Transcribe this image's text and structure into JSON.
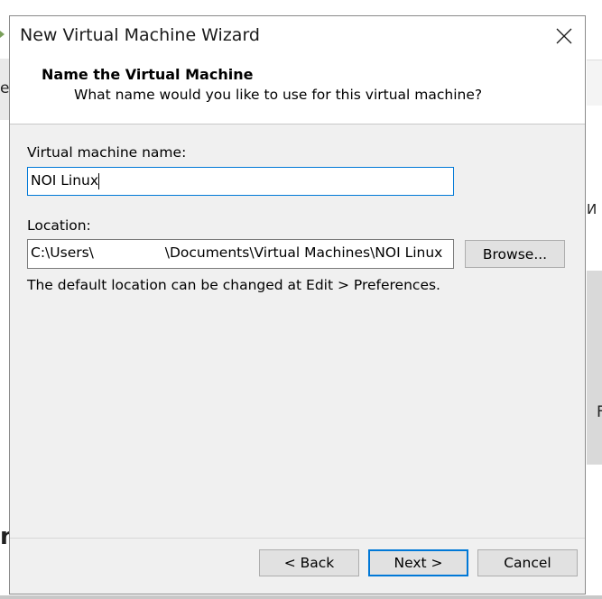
{
  "background": {
    "left_fragment": "e",
    "right_fragment_1": "И",
    "right_fragment_2": "F",
    "left_bottom_fragment": "n"
  },
  "dialog": {
    "title": "New Virtual Machine Wizard",
    "header_title": "Name the Virtual Machine",
    "header_subtitle": "What name would you like to use for this virtual machine?",
    "name_label": "Virtual machine name:",
    "name_value": "NOI Linux",
    "location_label": "Location:",
    "location_value": "C:\\Users\\                \\Documents\\Virtual Machines\\NOI Linux",
    "browse_label": "Browse...",
    "hint": "The default location can be changed at Edit > Preferences.",
    "back_label": "< Back",
    "next_label": "Next >",
    "cancel_label": "Cancel"
  },
  "colors": {
    "focus_accent": "#0078d7",
    "dialog_bg": "#f0f0f0"
  },
  "icons": {
    "close": "close-icon"
  }
}
